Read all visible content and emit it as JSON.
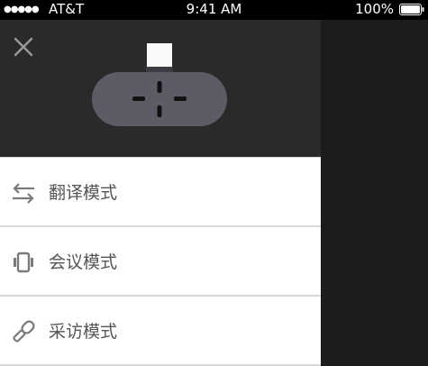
{
  "status_bar": {
    "signal": "●●●●●",
    "carrier": "AT&T",
    "time": "9:41 AM",
    "battery": "100%"
  },
  "drawer": {
    "close_icon": "close-icon",
    "device_image": "translator-device-illustration",
    "menu": [
      {
        "label": "翻译模式",
        "icon": "swap-arrows-icon"
      },
      {
        "label": "会议模式",
        "icon": "meeting-vibrate-icon"
      },
      {
        "label": "采访模式",
        "icon": "microphone-icon"
      }
    ]
  },
  "colors": {
    "header_bg": "#2a2a2a",
    "overlay_bg": "#1c1c1c",
    "device_body": "#5d5c66",
    "label_text": "#555555",
    "icon_gray": "#7a7a7a"
  }
}
